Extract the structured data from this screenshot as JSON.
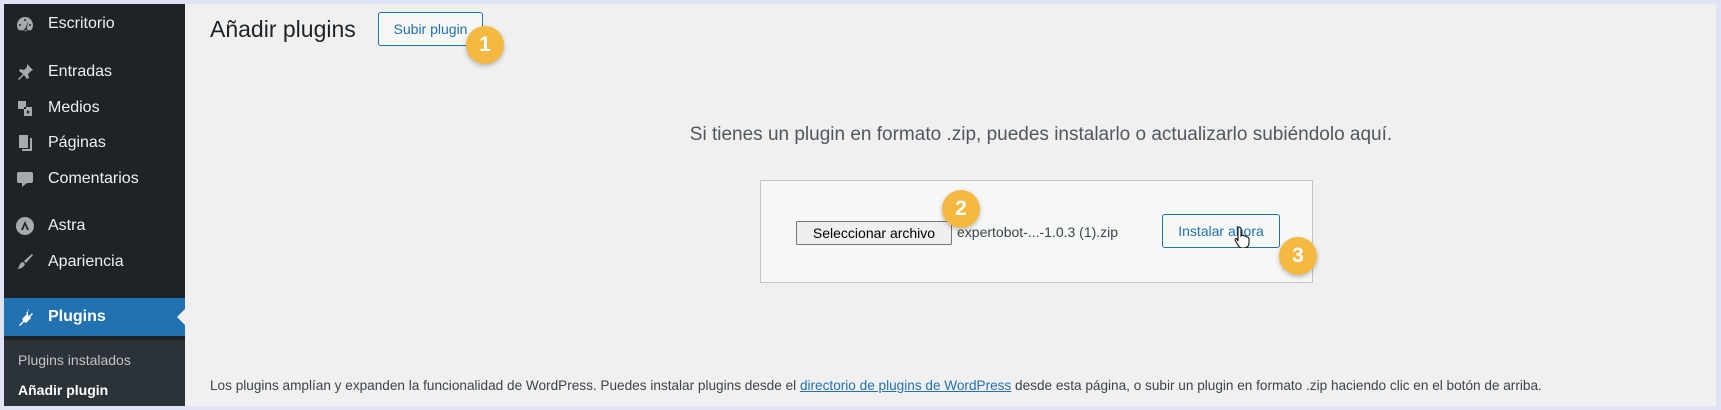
{
  "sidebar": {
    "items": [
      {
        "label": "Escritorio",
        "icon": "dashboard-icon"
      },
      {
        "label": "Entradas",
        "icon": "pin-icon"
      },
      {
        "label": "Medios",
        "icon": "media-icon"
      },
      {
        "label": "Páginas",
        "icon": "pages-icon"
      },
      {
        "label": "Comentarios",
        "icon": "comments-icon"
      },
      {
        "label": "Astra",
        "icon": "astra-icon"
      },
      {
        "label": "Apariencia",
        "icon": "brush-icon"
      },
      {
        "label": "Plugins",
        "icon": "plugins-icon"
      }
    ],
    "submenu": [
      {
        "label": "Plugins instalados"
      },
      {
        "label": "Añadir plugin"
      }
    ]
  },
  "header": {
    "title": "Añadir plugins",
    "upload_button": "Subir plugin"
  },
  "upload": {
    "intro": "Si tienes un plugin en formato .zip, puedes instalarlo o actualizarlo subiéndolo aquí.",
    "file_button": "Seleccionar archivo",
    "file_name": "expertobot-...-1.0.3 (1).zip",
    "install_button": "Instalar ahora"
  },
  "badges": [
    "1",
    "2",
    "3"
  ],
  "footer": {
    "text_before": "Los plugins amplían y expanden la funcionalidad de WordPress. Puedes instalar plugins desde el ",
    "link": "directorio de plugins de WordPress",
    "text_after": " desde esta página, o subir un plugin en formato .zip haciendo clic en el botón de arriba."
  },
  "colors": {
    "sidebar_bg": "#1d2327",
    "active": "#2271b1",
    "badge": "#f5b942",
    "content_bg": "#f0f0f1"
  }
}
